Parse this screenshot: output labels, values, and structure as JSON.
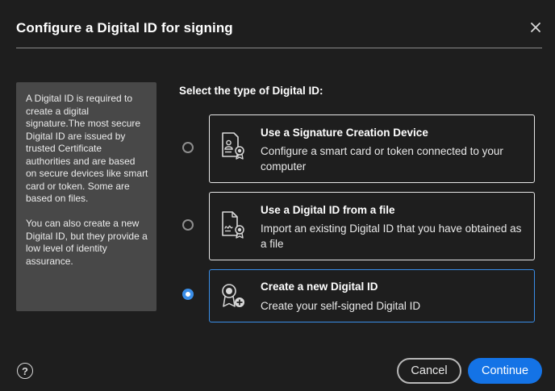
{
  "dialog": {
    "title": "Configure a Digital ID for signing",
    "close_icon": "close-icon"
  },
  "info": {
    "paragraph1": "A Digital ID is required to create a digital signature.The most secure Digital ID are issued by trusted Certificate authorities and are based on secure devices like smart card or token. Some are based on files.",
    "paragraph2": "You can also create a new Digital ID, but they provide a low level of identity assurance."
  },
  "select_heading": "Select the type of Digital ID:",
  "options": [
    {
      "title": "Use a Signature Creation Device",
      "description": "Configure a smart card or token connected to your computer",
      "icon": "signature-device-icon",
      "selected": false
    },
    {
      "title": "Use a Digital ID from a file",
      "description": "Import an existing Digital ID that you have obtained as a file",
      "icon": "digital-id-file-icon",
      "selected": false
    },
    {
      "title": "Create a new Digital ID",
      "description": "Create your self-signed Digital ID",
      "icon": "new-digital-id-icon",
      "selected": true
    }
  ],
  "footer": {
    "help_label": "?",
    "cancel_label": "Cancel",
    "continue_label": "Continue"
  },
  "colors": {
    "background": "#1e1e1e",
    "accent": "#3a8ee8",
    "primary_button": "#1473e6",
    "info_panel": "#484848"
  }
}
